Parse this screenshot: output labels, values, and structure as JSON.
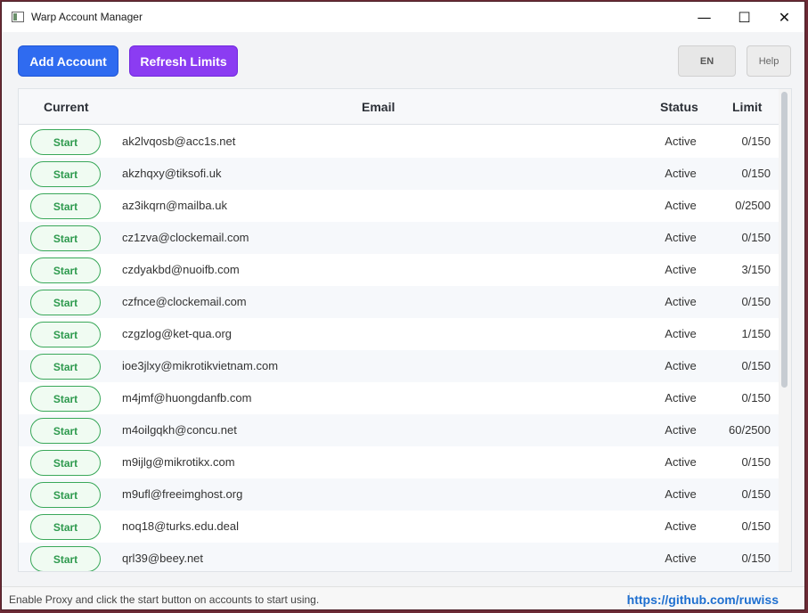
{
  "window": {
    "title": "Warp Account Manager",
    "min_glyph": "—",
    "max_glyph": "☐",
    "close_glyph": "✕"
  },
  "toolbar": {
    "add_label": "Add Account",
    "refresh_label": "Refresh Limits",
    "lang_label": "EN",
    "help_label": "Help"
  },
  "table": {
    "headers": {
      "current": "Current",
      "email": "Email",
      "status": "Status",
      "limit": "Limit"
    },
    "start_label": "Start",
    "rows": [
      {
        "email": "ak2lvqosb@acc1s.net",
        "status": "Active",
        "limit": "0/150"
      },
      {
        "email": "akzhqxy@tiksofi.uk",
        "status": "Active",
        "limit": "0/150"
      },
      {
        "email": "az3ikqrn@mailba.uk",
        "status": "Active",
        "limit": "0/2500"
      },
      {
        "email": "cz1zva@clockemail.com",
        "status": "Active",
        "limit": "0/150"
      },
      {
        "email": "czdyakbd@nuoifb.com",
        "status": "Active",
        "limit": "3/150"
      },
      {
        "email": "czfnce@clockemail.com",
        "status": "Active",
        "limit": "0/150"
      },
      {
        "email": "czgzlog@ket-qua.org",
        "status": "Active",
        "limit": "1/150"
      },
      {
        "email": "ioe3jlxy@mikrotikvietnam.com",
        "status": "Active",
        "limit": "0/150"
      },
      {
        "email": "m4jmf@huongdanfb.com",
        "status": "Active",
        "limit": "0/150"
      },
      {
        "email": "m4oilgqkh@concu.net",
        "status": "Active",
        "limit": "60/2500"
      },
      {
        "email": "m9ijlg@mikrotikx.com",
        "status": "Active",
        "limit": "0/150"
      },
      {
        "email": "m9ufl@freeimghost.org",
        "status": "Active",
        "limit": "0/150"
      },
      {
        "email": "noq18@turks.edu.deal",
        "status": "Active",
        "limit": "0/150"
      },
      {
        "email": "qrl39@beey.net",
        "status": "Active",
        "limit": "0/150"
      },
      {
        "email": "",
        "status": "",
        "limit": ""
      }
    ]
  },
  "statusbar": {
    "message": "Enable Proxy and click the start button on accounts to start using.",
    "link": "https://github.com/ruwiss"
  }
}
